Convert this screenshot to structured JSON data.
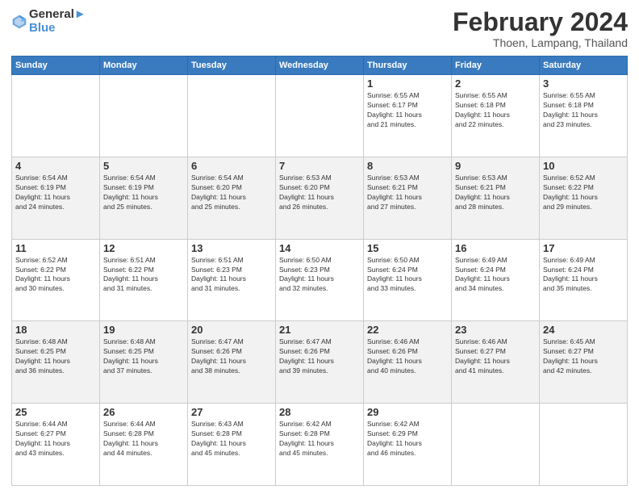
{
  "header": {
    "logo_line1": "General",
    "logo_line2": "Blue",
    "title": "February 2024",
    "subtitle": "Thoen, Lampang, Thailand"
  },
  "days_of_week": [
    "Sunday",
    "Monday",
    "Tuesday",
    "Wednesday",
    "Thursday",
    "Friday",
    "Saturday"
  ],
  "weeks": [
    [
      {
        "day": "",
        "info": ""
      },
      {
        "day": "",
        "info": ""
      },
      {
        "day": "",
        "info": ""
      },
      {
        "day": "",
        "info": ""
      },
      {
        "day": "1",
        "info": "Sunrise: 6:55 AM\nSunset: 6:17 PM\nDaylight: 11 hours\nand 21 minutes."
      },
      {
        "day": "2",
        "info": "Sunrise: 6:55 AM\nSunset: 6:18 PM\nDaylight: 11 hours\nand 22 minutes."
      },
      {
        "day": "3",
        "info": "Sunrise: 6:55 AM\nSunset: 6:18 PM\nDaylight: 11 hours\nand 23 minutes."
      }
    ],
    [
      {
        "day": "4",
        "info": "Sunrise: 6:54 AM\nSunset: 6:19 PM\nDaylight: 11 hours\nand 24 minutes."
      },
      {
        "day": "5",
        "info": "Sunrise: 6:54 AM\nSunset: 6:19 PM\nDaylight: 11 hours\nand 25 minutes."
      },
      {
        "day": "6",
        "info": "Sunrise: 6:54 AM\nSunset: 6:20 PM\nDaylight: 11 hours\nand 25 minutes."
      },
      {
        "day": "7",
        "info": "Sunrise: 6:53 AM\nSunset: 6:20 PM\nDaylight: 11 hours\nand 26 minutes."
      },
      {
        "day": "8",
        "info": "Sunrise: 6:53 AM\nSunset: 6:21 PM\nDaylight: 11 hours\nand 27 minutes."
      },
      {
        "day": "9",
        "info": "Sunrise: 6:53 AM\nSunset: 6:21 PM\nDaylight: 11 hours\nand 28 minutes."
      },
      {
        "day": "10",
        "info": "Sunrise: 6:52 AM\nSunset: 6:22 PM\nDaylight: 11 hours\nand 29 minutes."
      }
    ],
    [
      {
        "day": "11",
        "info": "Sunrise: 6:52 AM\nSunset: 6:22 PM\nDaylight: 11 hours\nand 30 minutes."
      },
      {
        "day": "12",
        "info": "Sunrise: 6:51 AM\nSunset: 6:22 PM\nDaylight: 11 hours\nand 31 minutes."
      },
      {
        "day": "13",
        "info": "Sunrise: 6:51 AM\nSunset: 6:23 PM\nDaylight: 11 hours\nand 31 minutes."
      },
      {
        "day": "14",
        "info": "Sunrise: 6:50 AM\nSunset: 6:23 PM\nDaylight: 11 hours\nand 32 minutes."
      },
      {
        "day": "15",
        "info": "Sunrise: 6:50 AM\nSunset: 6:24 PM\nDaylight: 11 hours\nand 33 minutes."
      },
      {
        "day": "16",
        "info": "Sunrise: 6:49 AM\nSunset: 6:24 PM\nDaylight: 11 hours\nand 34 minutes."
      },
      {
        "day": "17",
        "info": "Sunrise: 6:49 AM\nSunset: 6:24 PM\nDaylight: 11 hours\nand 35 minutes."
      }
    ],
    [
      {
        "day": "18",
        "info": "Sunrise: 6:48 AM\nSunset: 6:25 PM\nDaylight: 11 hours\nand 36 minutes."
      },
      {
        "day": "19",
        "info": "Sunrise: 6:48 AM\nSunset: 6:25 PM\nDaylight: 11 hours\nand 37 minutes."
      },
      {
        "day": "20",
        "info": "Sunrise: 6:47 AM\nSunset: 6:26 PM\nDaylight: 11 hours\nand 38 minutes."
      },
      {
        "day": "21",
        "info": "Sunrise: 6:47 AM\nSunset: 6:26 PM\nDaylight: 11 hours\nand 39 minutes."
      },
      {
        "day": "22",
        "info": "Sunrise: 6:46 AM\nSunset: 6:26 PM\nDaylight: 11 hours\nand 40 minutes."
      },
      {
        "day": "23",
        "info": "Sunrise: 6:46 AM\nSunset: 6:27 PM\nDaylight: 11 hours\nand 41 minutes."
      },
      {
        "day": "24",
        "info": "Sunrise: 6:45 AM\nSunset: 6:27 PM\nDaylight: 11 hours\nand 42 minutes."
      }
    ],
    [
      {
        "day": "25",
        "info": "Sunrise: 6:44 AM\nSunset: 6:27 PM\nDaylight: 11 hours\nand 43 minutes."
      },
      {
        "day": "26",
        "info": "Sunrise: 6:44 AM\nSunset: 6:28 PM\nDaylight: 11 hours\nand 44 minutes."
      },
      {
        "day": "27",
        "info": "Sunrise: 6:43 AM\nSunset: 6:28 PM\nDaylight: 11 hours\nand 45 minutes."
      },
      {
        "day": "28",
        "info": "Sunrise: 6:42 AM\nSunset: 6:28 PM\nDaylight: 11 hours\nand 45 minutes."
      },
      {
        "day": "29",
        "info": "Sunrise: 6:42 AM\nSunset: 6:29 PM\nDaylight: 11 hours\nand 46 minutes."
      },
      {
        "day": "",
        "info": ""
      },
      {
        "day": "",
        "info": ""
      }
    ]
  ]
}
